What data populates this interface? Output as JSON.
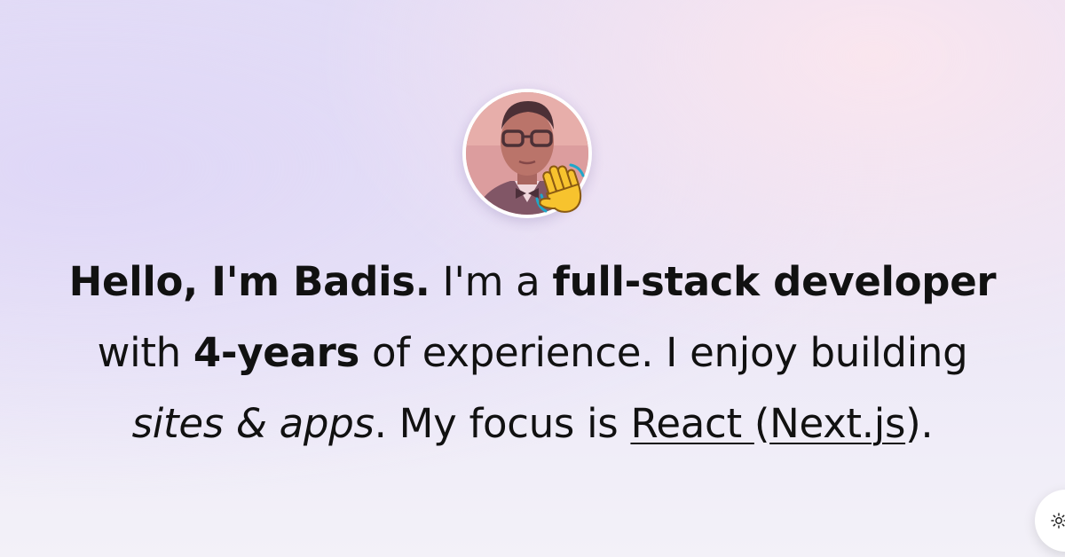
{
  "hero": {
    "avatar_icon": "profile-photo",
    "wave_icon": "waving-hand-emoji",
    "intro": {
      "greeting": "Hello, I'm Badis.",
      "text_1": " I'm a ",
      "role": "full-stack developer",
      "text_2": " with ",
      "experience": "4-years",
      "text_3": " of experience. I enjoy building ",
      "interests": "sites & apps",
      "text_4": ". My focus is ",
      "focus_link_1": "React ",
      "text_5": "(",
      "focus_link_2": "Next.js",
      "text_6": ")."
    }
  },
  "theme_toggle": {
    "icon": "sun-icon"
  }
}
